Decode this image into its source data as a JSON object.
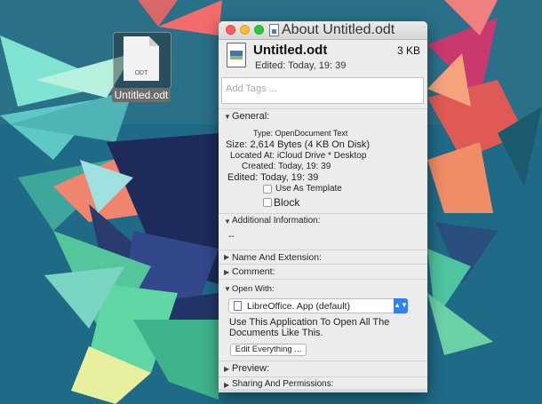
{
  "desktop": {
    "file": {
      "name": "Untitled.odt",
      "badge": "ODT"
    }
  },
  "window": {
    "title": "About Untitled.odt",
    "file_name": "Untitled.odt",
    "file_size": "3 KB",
    "edited_header": "Edited: Today, 19: 39",
    "tags_placeholder": "Add Tags ...",
    "general": {
      "title": "General:",
      "type": "Type: OpenDocument Text",
      "size": "Size: 2,614 Bytes (4 KB On Disk)",
      "location": "Located At: iCloud Drive * Desktop",
      "created": "Created: Today, 19: 39",
      "edited": "Edited: Today, 19: 39",
      "template_label": "Use As Template",
      "block_label": "Block"
    },
    "additional": {
      "title": "Additional Information:",
      "value": "--"
    },
    "name_ext": {
      "title": "Name And Extension:"
    },
    "comment": {
      "title": "Comment:"
    },
    "open_with": {
      "title": "Open With:",
      "selected": "LibreOffice. App (default)",
      "description": "Use This Application To Open All The Documents Like This.",
      "button": "Edit Everything ..."
    },
    "preview": {
      "title": "Preview:"
    },
    "sharing": {
      "title": "Sharing And Permissions:"
    }
  },
  "colors": {
    "desktop_bg": "#1f6a86",
    "close": "#fc5f57",
    "minimize": "#fdbc2e",
    "zoom": "#28c840",
    "select_accent": "#2f7ff5"
  }
}
